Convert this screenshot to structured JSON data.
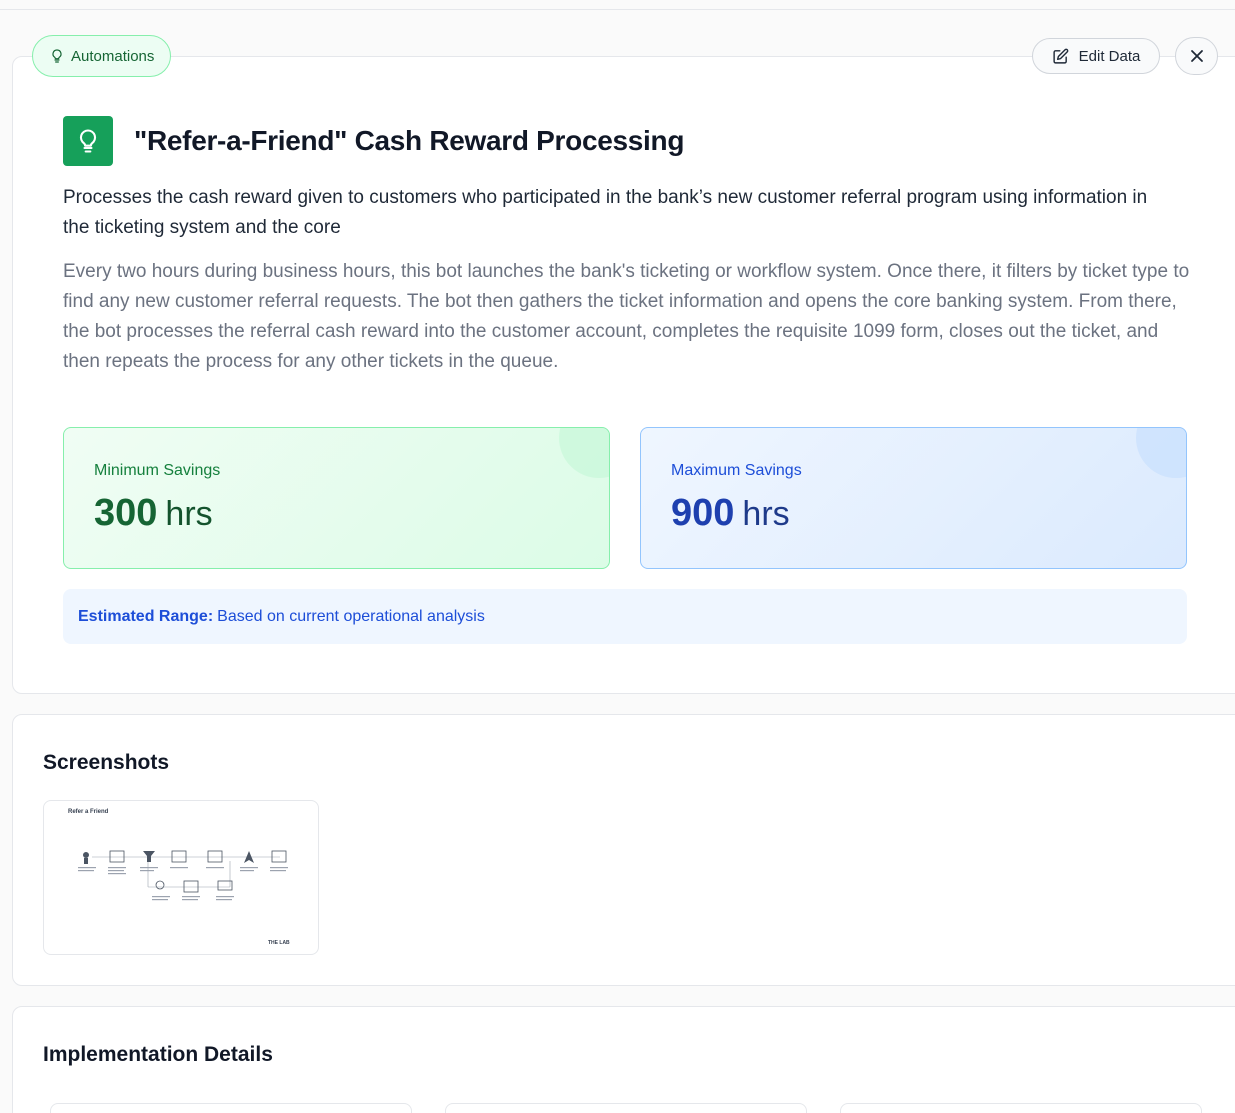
{
  "badge": {
    "label": "Automations",
    "icon": "lightbulb-icon"
  },
  "toolbar": {
    "edit_label": "Edit Data",
    "close_icon": "close-icon",
    "edit_icon": "edit-icon"
  },
  "automation": {
    "title": "\"Refer-a-Friend\" Cash Reward Processing",
    "subtitle": "Processes the cash reward given to customers who participated in the bank’s new customer referral program using information in the ticketing system and the core",
    "description": "Every two hours during business hours, this bot launches the bank's ticketing or workflow system. Once there, it filters by ticket type to find any new customer referral requests. The bot then gathers the ticket information and opens the core banking system. From there, the bot processes the referral cash reward into the customer account, completes the requisite 1099 form, closes out the ticket, and then repeats the process for any other tickets in the queue."
  },
  "savings": {
    "min": {
      "label": "Minimum Savings",
      "value": "300",
      "unit": "hrs"
    },
    "max": {
      "label": "Maximum Savings",
      "value": "900",
      "unit": "hrs"
    }
  },
  "range_note": {
    "bold": "Estimated Range:",
    "text": "Based on current operational analysis"
  },
  "screenshots": {
    "heading": "Screenshots",
    "items": [
      {
        "caption": "Refer a Friend",
        "footer": "THE LAB"
      }
    ]
  },
  "implementation": {
    "heading": "Implementation Details"
  },
  "colors": {
    "accent_green": "#16a05a",
    "min_text": "#166534",
    "max_text": "#1e40af",
    "range_text": "#1d4ed8"
  }
}
